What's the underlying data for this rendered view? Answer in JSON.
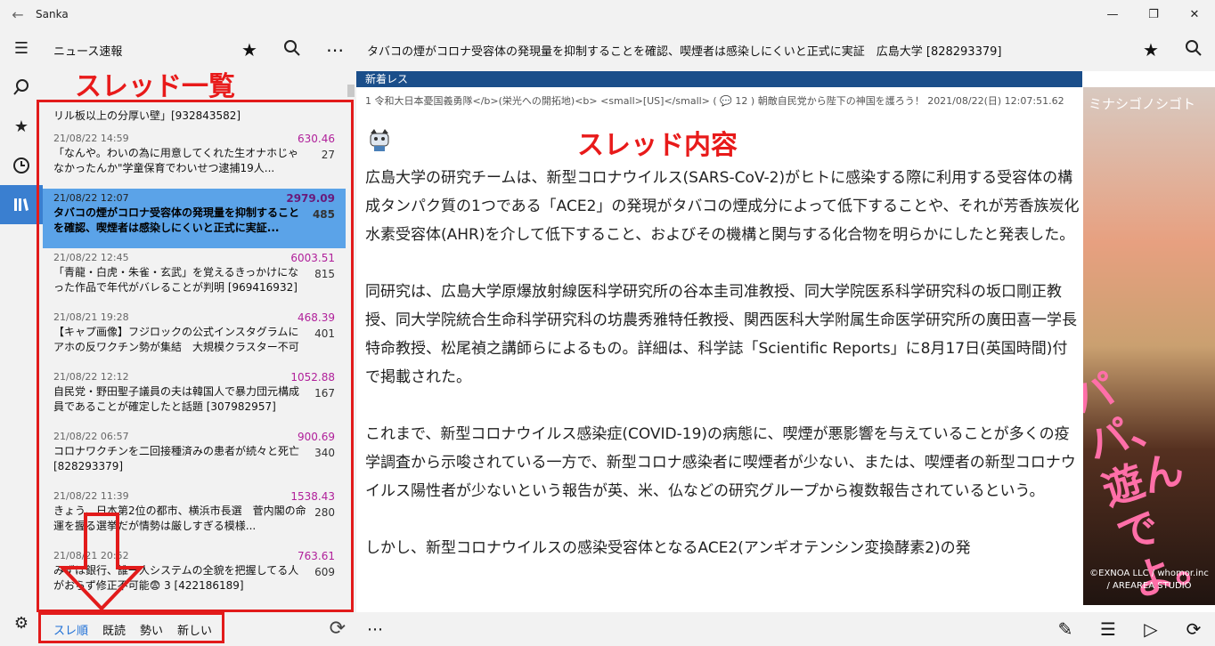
{
  "window": {
    "title": "Sanka"
  },
  "list": {
    "board_name": "ニュース速報",
    "first_row_title": "リル板以上の分厚い壁」[932843582]",
    "threads": [
      {
        "date": "21/08/22 14:59",
        "score": "630.46",
        "count": "27",
        "title": "「なんや。わいの為に用意してくれた生オナホじゃなかったんか\"学童保育でわいせつ逮捕19人..."
      },
      {
        "date": "21/08/22 12:07",
        "score": "2979.09",
        "count": "485",
        "title": "タバコの煙がコロナ受容体の発現量を抑制することを確認、喫煙者は感染しにくいと正式に実証...",
        "selected": true
      },
      {
        "date": "21/08/22 12:45",
        "score": "6003.51",
        "count": "815",
        "title": "「青龍・白虎・朱雀・玄武」を覚えるきっかけになった作品で年代がバレることが判明 [969416932]"
      },
      {
        "date": "21/08/21 19:28",
        "score": "468.39",
        "count": "401",
        "title": "【キャプ画像】フジロックの公式インスタグラムにアホの反ワクチン勢が集結　大規模クラスター不可避..."
      },
      {
        "date": "21/08/22 12:12",
        "score": "1052.88",
        "count": "167",
        "title": "自民党・野田聖子議員の夫は韓国人で暴力団元構成員であることが確定したと話題 [307982957]"
      },
      {
        "date": "21/08/22 06:57",
        "score": "900.69",
        "count": "340",
        "title": "コロナワクチンを二回接種済みの患者が続々と死亡 [828293379]"
      },
      {
        "date": "21/08/22 11:39",
        "score": "1538.43",
        "count": "280",
        "title": "きょう、日本第2位の都市、横浜市長選　菅内閣の命運を握る選挙だが情勢は厳しすぎる模様..."
      },
      {
        "date": "21/08/21 20:52",
        "score": "763.61",
        "count": "609",
        "title": "みずほ銀行、誰一人システムの全貌を把握してる人がおらず修正不可能😨 3 [422186189]"
      }
    ],
    "tabs": [
      {
        "label": "スレ順",
        "active": true
      },
      {
        "label": "既読"
      },
      {
        "label": "勢い"
      },
      {
        "label": "新しい"
      }
    ]
  },
  "annotations": {
    "thread_list": "スレッド一覧",
    "thread_content": "スレッド内容"
  },
  "content": {
    "thread_title": "タバコの煙がコロナ受容体の発現量を抑制することを確認、喫煙者は感染しにくいと正式に実証　広島大学 [828293379]",
    "new_label": "新着レス",
    "post_meta_a": "1 令和大日本憂国義勇隊</b>(栄光への開拓地)<b> <small>[US]</small> (",
    "post_reply_count": "12",
    "post_meta_b": ") 朝敵自民党から陛下の神国を護ろう！ 2021/08/22(日) 12:07:51.62",
    "paragraphs": [
      "広島大学の研究チームは、新型コロナウイルス(SARS-CoV-2)がヒトに感染する際に利用する受容体の構成タンパク質の1つである「ACE2」の発現がタバコの煙成分によって低下することや、それが芳香族炭化水素受容体(AHR)を介して低下すること、およびその機構と関与する化合物を明らかにしたと発表した。",
      "同研究は、広島大学原爆放射線医科学研究所の谷本圭司准教授、同大学院医系科学研究科の坂口剛正教授、同大学院統合生命科学研究科の坊農秀雅特任教授、関西医科大学附属生命医学研究所の廣田喜一学長特命教授、松尾禎之講師らによるもの。詳細は、科学誌「Scientific Reports」に8月17日(英国時間)付で掲載された。",
      "これまで、新型コロナウイルス感染症(COVID-19)の病態に、喫煙が悪影響を与えていることが多くの疫学調査から示唆されている一方で、新型コロナ感染者に喫煙者が少ない、または、喫煙者の新型コロナウイルス陽性者が少ないという報告が英、米、仏などの研究グループから複数報告されているという。",
      "しかし、新型コロナウイルスの感染受容体となるACE2(アンギオテンシン変換酵素2)の発"
    ]
  },
  "ad": {
    "logo": "ミナシゴノシゴト",
    "tagline": "パパ、遊んでよ。",
    "copyright": "©EXNOA LLC / whomor.inc / AREAREA STUDIO"
  }
}
